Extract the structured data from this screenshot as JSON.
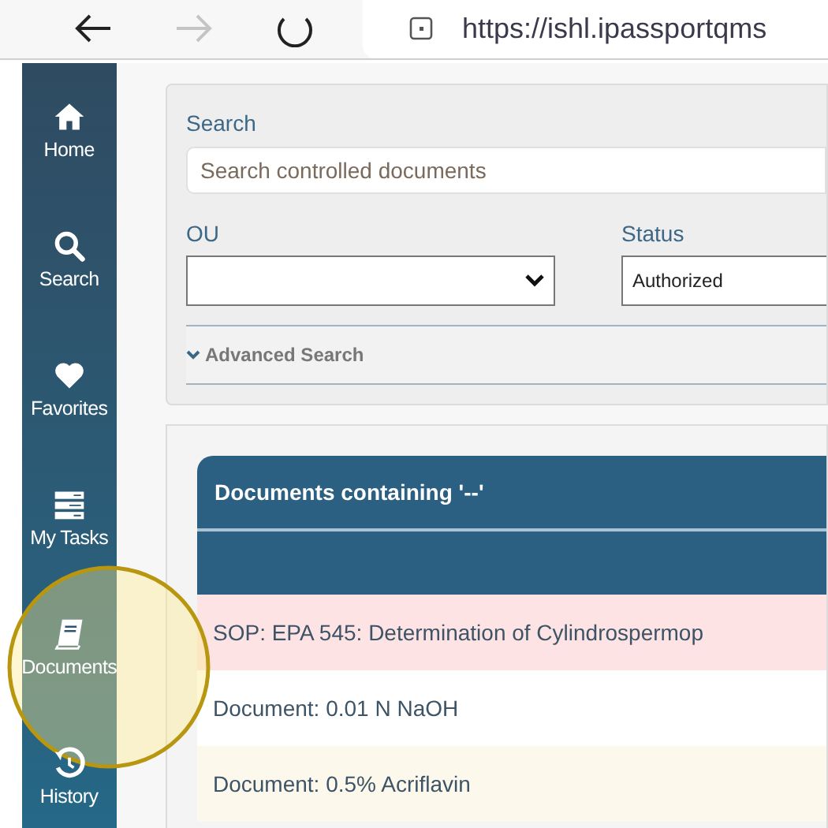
{
  "browser": {
    "url": "https://ishl.ipassportqms"
  },
  "sidebar": {
    "items": [
      {
        "kind": "home",
        "label": "Home"
      },
      {
        "kind": "search",
        "label": "Search"
      },
      {
        "kind": "favorites",
        "label": "Favorites"
      },
      {
        "kind": "tasks",
        "label": "My Tasks"
      },
      {
        "kind": "documents",
        "label": "Documents"
      },
      {
        "kind": "history",
        "label": "History"
      }
    ]
  },
  "search_panel": {
    "search_label": "Search",
    "search_placeholder": "Search controlled documents",
    "ou_label": "OU",
    "status_label": "Status",
    "status_value": "Authorized",
    "advanced": "Advanced Search",
    "advanced_expanded": false
  },
  "results": {
    "title": "Documents containing '--'",
    "rows": [
      {
        "text": "SOP: EPA 545: Determination of Cylindrospermop",
        "kind": "alert"
      },
      {
        "text": "Document: 0.01 N NaOH",
        "kind": "plain"
      },
      {
        "text": "Document: 0.5% Acriflavin",
        "kind": "note"
      }
    ]
  }
}
